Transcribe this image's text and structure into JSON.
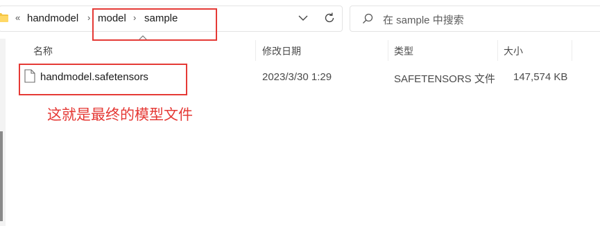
{
  "address_bar": {
    "overflow_chevron": "«",
    "crumbs": [
      "handmodel",
      "model",
      "sample"
    ],
    "separator": "›"
  },
  "search": {
    "placeholder": "在 sample 中搜索"
  },
  "columns": {
    "name": "名称",
    "modified": "修改日期",
    "type": "类型",
    "size": "大小"
  },
  "files": [
    {
      "name": "handmodel.safetensors",
      "modified": "2023/3/30 1:29",
      "type": "SAFETENSORS 文件",
      "size": "147,574 KB"
    }
  ],
  "annotation": {
    "text": "这就是最终的模型文件",
    "color": "#e53935"
  },
  "icons": {
    "folder": "folder-icon",
    "dropdown": "chevron-down-icon",
    "refresh": "refresh-icon",
    "search": "search-icon",
    "file": "file-icon",
    "sort": "sort-up-icon"
  }
}
